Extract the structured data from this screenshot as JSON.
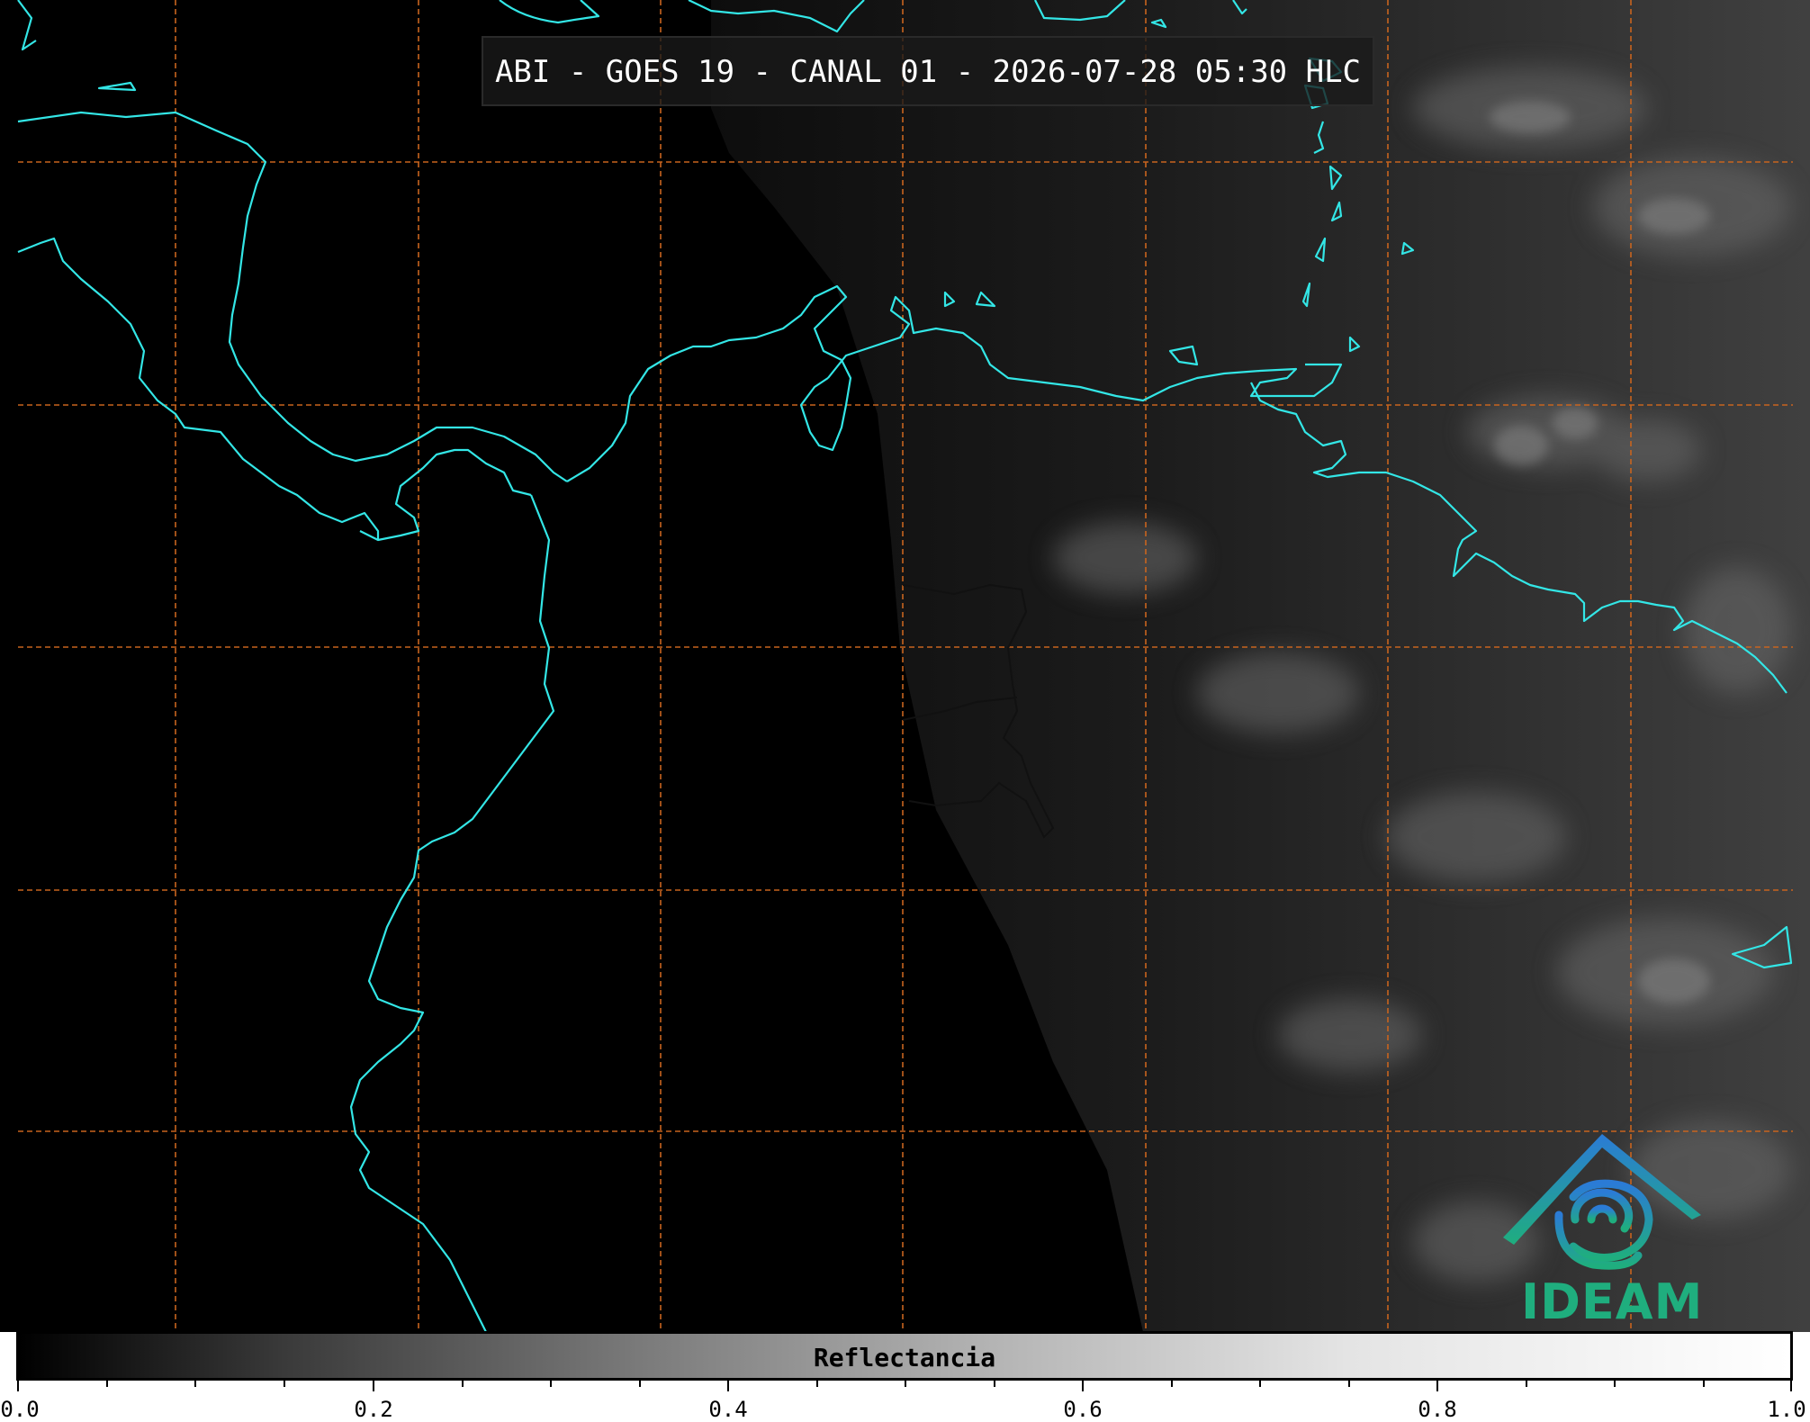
{
  "title": "ABI - GOES 19 - CANAL 01 - 2026-07-28 05:30 HLC",
  "colorbar": {
    "label": "Reflectancia",
    "ticks": [
      "0.0",
      "0.2",
      "0.4",
      "0.6",
      "0.8",
      "1.0"
    ],
    "range": [
      0.0,
      1.0
    ],
    "colormap": "grayscale"
  },
  "logo": {
    "text": "IDEAM"
  },
  "colors": {
    "coastline": "#33e6e6",
    "grid": "#c8641e",
    "background": "#000000",
    "logo_blue": "#2b7bd6",
    "logo_green": "#1fae7e"
  },
  "icons": [
    "ideam-logo-icon"
  ]
}
